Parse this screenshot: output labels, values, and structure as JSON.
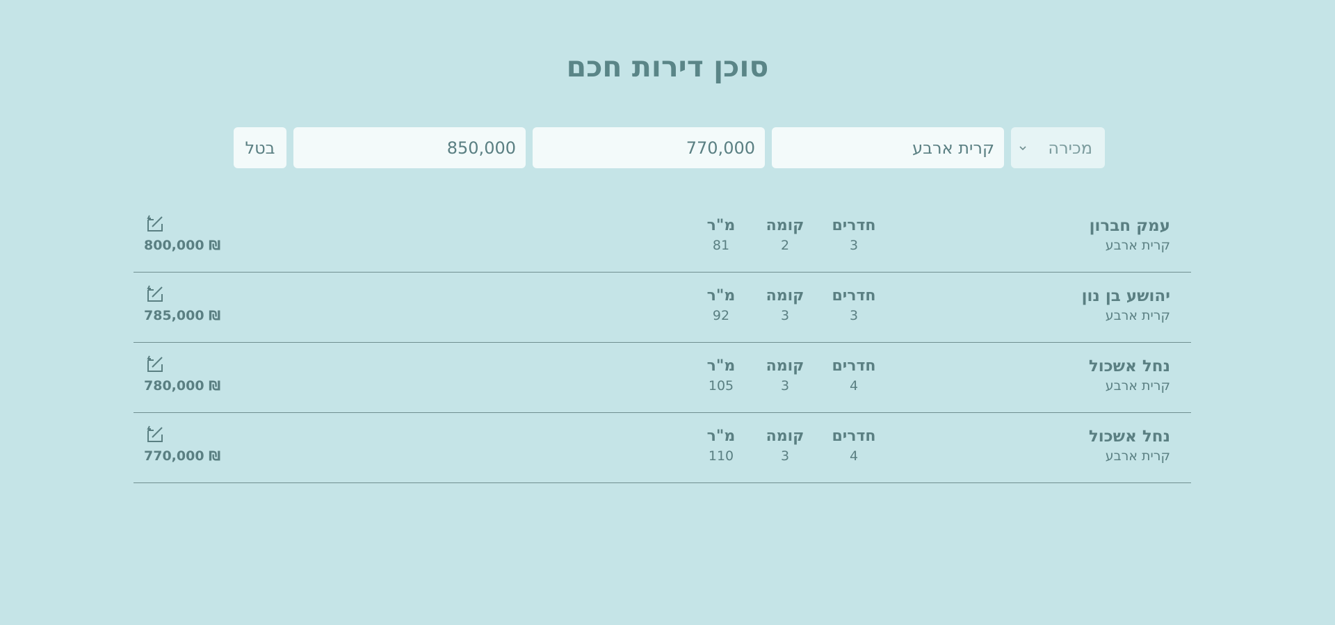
{
  "header": {
    "title": "סוכן דירות חכם"
  },
  "search": {
    "deal_type": "מכירה",
    "city": "קרית ארבע",
    "min_price": "770,000",
    "max_price": "850,000",
    "cancel_label": "בטל"
  },
  "columns": {
    "rooms": "חדרים",
    "floor": "קומה",
    "sqm": "מ\"ר"
  },
  "listings": [
    {
      "street": "עמק חברון",
      "city": "קרית ארבע",
      "rooms": "3",
      "floor": "2",
      "sqm": "81",
      "price": "800,000 ₪"
    },
    {
      "street": "יהושע בן נון",
      "city": "קרית ארבע",
      "rooms": "3",
      "floor": "3",
      "sqm": "92",
      "price": "785,000 ₪"
    },
    {
      "street": "נחל אשכול",
      "city": "קרית ארבע",
      "rooms": "4",
      "floor": "3",
      "sqm": "105",
      "price": "780,000 ₪"
    },
    {
      "street": "נחל אשכול",
      "city": "קרית ארבע",
      "rooms": "4",
      "floor": "3",
      "sqm": "110",
      "price": "770,000 ₪"
    }
  ],
  "icons": {
    "row_action": "edit-icon",
    "select_arrow": "chevron-down-icon"
  },
  "colors": {
    "background": "#c5e4e7",
    "text": "#5a7f82",
    "field_bg": "#f3fafa"
  }
}
